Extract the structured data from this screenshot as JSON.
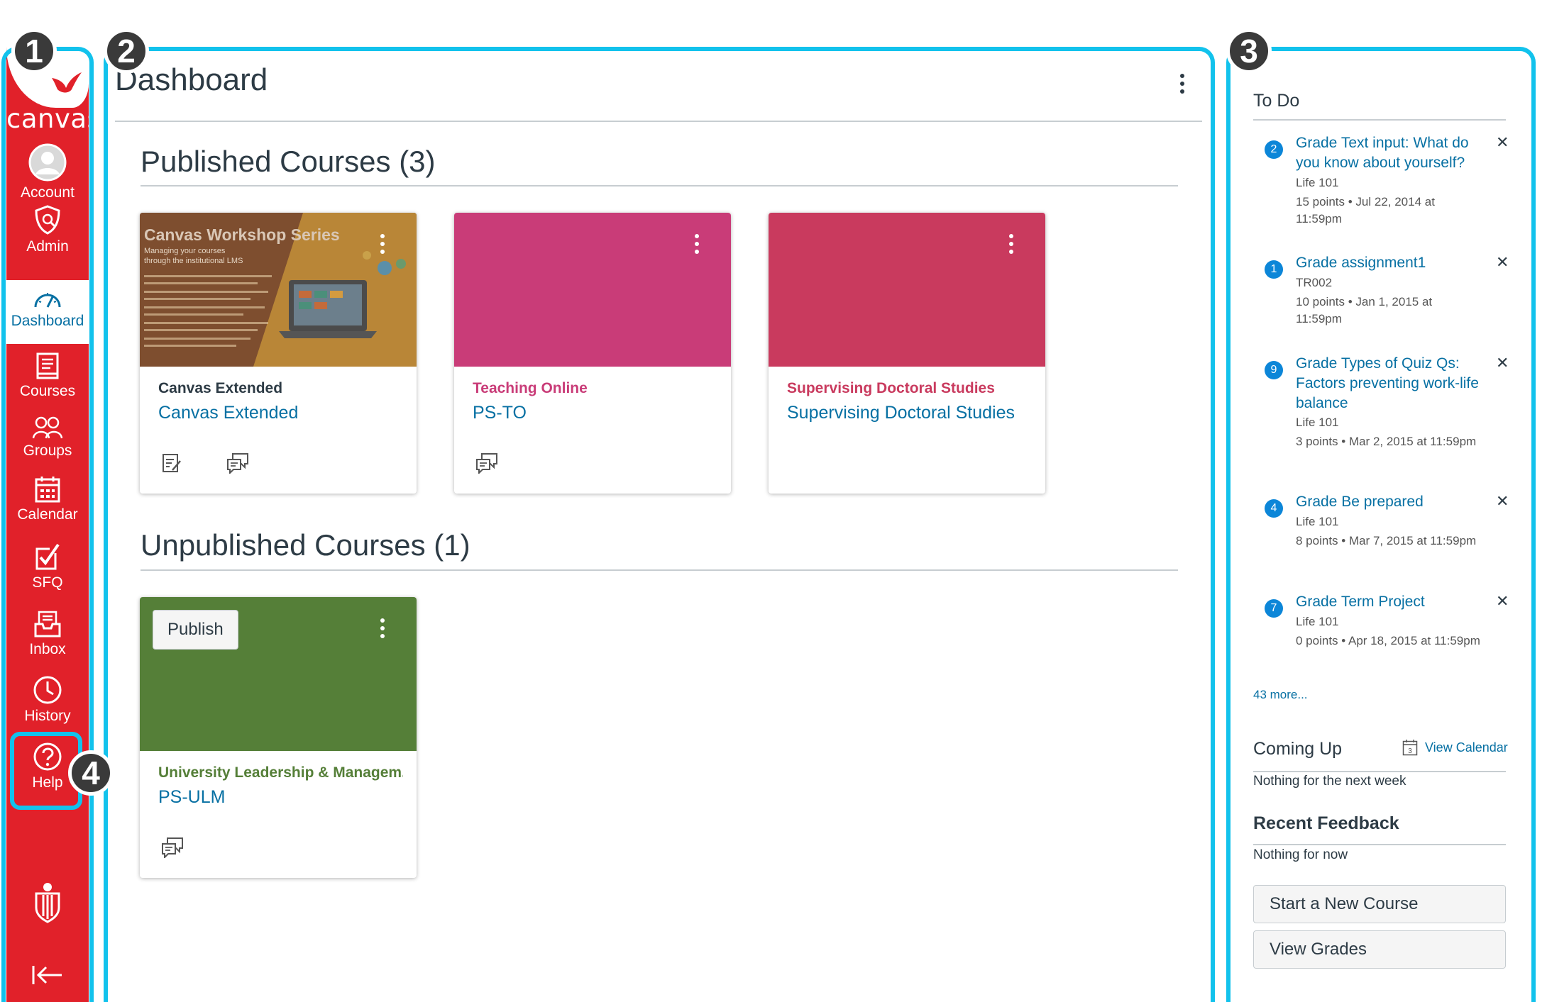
{
  "badges": [
    "1",
    "2",
    "3",
    "4"
  ],
  "nav": {
    "brand": "canvas",
    "items": [
      {
        "label": "Account",
        "icon": "account-icon"
      },
      {
        "label": "Admin",
        "icon": "admin-shield-icon"
      },
      {
        "label": "Dashboard",
        "icon": "dashboard-gauge-icon"
      },
      {
        "label": "Courses",
        "icon": "courses-book-icon"
      },
      {
        "label": "Groups",
        "icon": "groups-icon"
      },
      {
        "label": "Calendar",
        "icon": "calendar-icon"
      },
      {
        "label": "SFQ",
        "icon": "sfq-checkbox-icon"
      },
      {
        "label": "Inbox",
        "icon": "inbox-icon"
      },
      {
        "label": "History",
        "icon": "history-clock-icon"
      },
      {
        "label": "Help",
        "icon": "help-question-icon"
      }
    ]
  },
  "main": {
    "title": "Dashboard",
    "published_title": "Published Courses (3)",
    "unpublished_title": "Unpublished Courses (1)",
    "published": [
      {
        "short": "Canvas Extended",
        "code": "Canvas Extended",
        "color": "#2d3b45",
        "hero_title": "Canvas Workshop Series",
        "hero_sub1": "Managing your courses",
        "hero_sub2": "through the institutional LMS"
      },
      {
        "short": "Teaching Online",
        "code": "PS-TO",
        "color": "#c93c78"
      },
      {
        "short": "Supervising Doctoral Studies",
        "code": "Supervising Doctoral Studies",
        "color": "#c93a5e"
      }
    ],
    "unpublished": [
      {
        "short": "University Leadership & Managem...",
        "code": "PS-ULM",
        "color": "#557f38",
        "publish_label": "Publish"
      }
    ]
  },
  "sidebar": {
    "todo_title": "To Do",
    "todos": [
      {
        "count": "2",
        "title": "Grade Text input: What do you know about yourself?",
        "course": "Life 101",
        "detail": "15 points • Jul 22, 2014 at 11:59pm"
      },
      {
        "count": "1",
        "title": "Grade assignment1",
        "course": "TR002",
        "detail": "10 points • Jan 1, 2015 at 11:59pm"
      },
      {
        "count": "9",
        "title": "Grade Types of Quiz Qs: Factors preventing work-life balance",
        "course": "Life 101",
        "detail": "3 points • Mar 2, 2015 at 11:59pm"
      },
      {
        "count": "4",
        "title": "Grade Be prepared",
        "course": "Life 101",
        "detail": "8 points • Mar 7, 2015 at 11:59pm"
      },
      {
        "count": "7",
        "title": "Grade Term Project",
        "course": "Life 101",
        "detail": "0 points • Apr 18, 2015 at 11:59pm"
      }
    ],
    "more": "43 more...",
    "coming_up": "Coming Up",
    "view_calendar": "View Calendar",
    "calendar_day": "3",
    "nothing_week": "Nothing for the next week",
    "recent_feedback": "Recent Feedback",
    "nothing_now": "Nothing for now",
    "start_course": "Start a New Course",
    "view_grades": "View Grades"
  },
  "colors": {
    "nav_red": "#e1212a",
    "link_blue": "#0770a3",
    "frame_cyan": "#12c2ec"
  }
}
